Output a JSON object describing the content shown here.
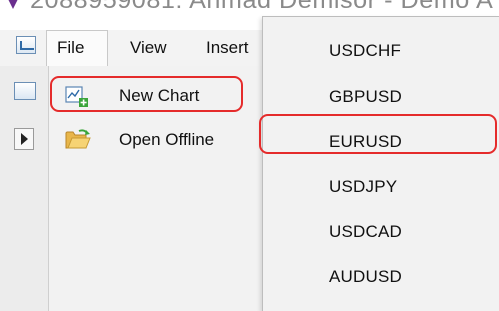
{
  "window": {
    "title": "2088959081: Ahmad Demisor - Demo A",
    "brand_color": "#6a2f8e"
  },
  "menubar": {
    "items": [
      {
        "label": "File"
      },
      {
        "label": "View"
      },
      {
        "label": "Insert"
      }
    ]
  },
  "file_menu": {
    "items": [
      {
        "label": "New Chart",
        "icon": "new-chart-icon",
        "highlighted": true
      },
      {
        "label": "Open Offline",
        "icon": "folder-open-icon",
        "highlighted": false
      }
    ]
  },
  "symbol_menu": {
    "items": [
      {
        "label": "USDCHF"
      },
      {
        "label": "GBPUSD"
      },
      {
        "label": "EURUSD",
        "highlighted": true
      },
      {
        "label": "USDJPY"
      },
      {
        "label": "USDCAD"
      },
      {
        "label": "AUDUSD"
      }
    ]
  },
  "colors": {
    "highlight_outline": "#e52b2b",
    "menu_background": "#f2f2f2"
  }
}
